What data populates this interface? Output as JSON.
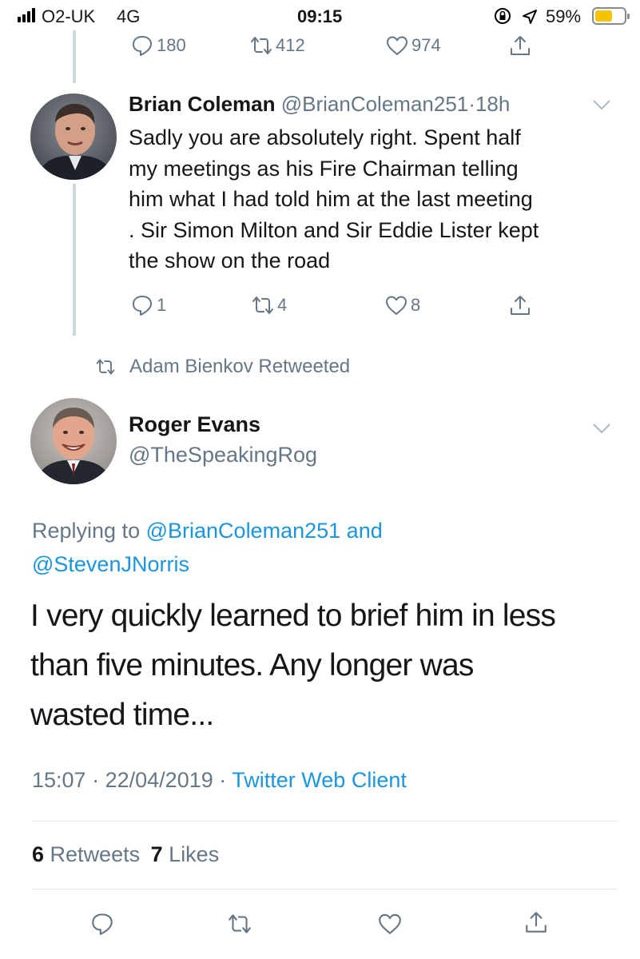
{
  "status_bar": {
    "carrier": "O2-UK",
    "network": "4G",
    "time": "09:15",
    "battery_percent": "59%",
    "battery_level": 0.59,
    "icons": [
      "signal-icon",
      "rotation-lock-icon",
      "location-icon",
      "battery-icon"
    ]
  },
  "parent_tweet": {
    "reply_count": "180",
    "retweet_count": "412",
    "like_count": "974"
  },
  "reply_tweet": {
    "display_name": "Brian Coleman",
    "handle": "@BrianColeman251",
    "time_sep": "·",
    "time_ago": "18h",
    "lines": [
      "Sadly you are absolutely right. Spent half",
      "my meetings as his Fire Chairman telling",
      "him what I had told him at the last meeting",
      ". Sir Simon Milton and Sir Eddie Lister kept",
      "the show on the road"
    ],
    "reply_count": "1",
    "retweet_count": "4",
    "like_count": "8"
  },
  "retweet_context": {
    "label": "Adam Bienkov Retweeted"
  },
  "main_tweet": {
    "display_name": "Roger Evans",
    "handle": "@TheSpeakingRog",
    "replying_prefix": "Replying to",
    "reply_to_1": "@BrianColeman251",
    "reply_and": "and",
    "reply_to_2": "@StevenJNorris",
    "lines": [
      "I very quickly learned to brief him in less",
      "than five minutes. Any longer was",
      "wasted time..."
    ],
    "time": "15:07",
    "dot": "·",
    "date": "22/04/2019",
    "dot2": "·",
    "client": "Twitter Web Client",
    "retweets_count": "6",
    "retweets_label": "Retweets",
    "likes_count": "7",
    "likes_label": "Likes"
  },
  "colors": {
    "link": "#1b95e0",
    "muted": "#657786",
    "thread_line": "#ccd6dd",
    "battery": "#f5c400"
  }
}
